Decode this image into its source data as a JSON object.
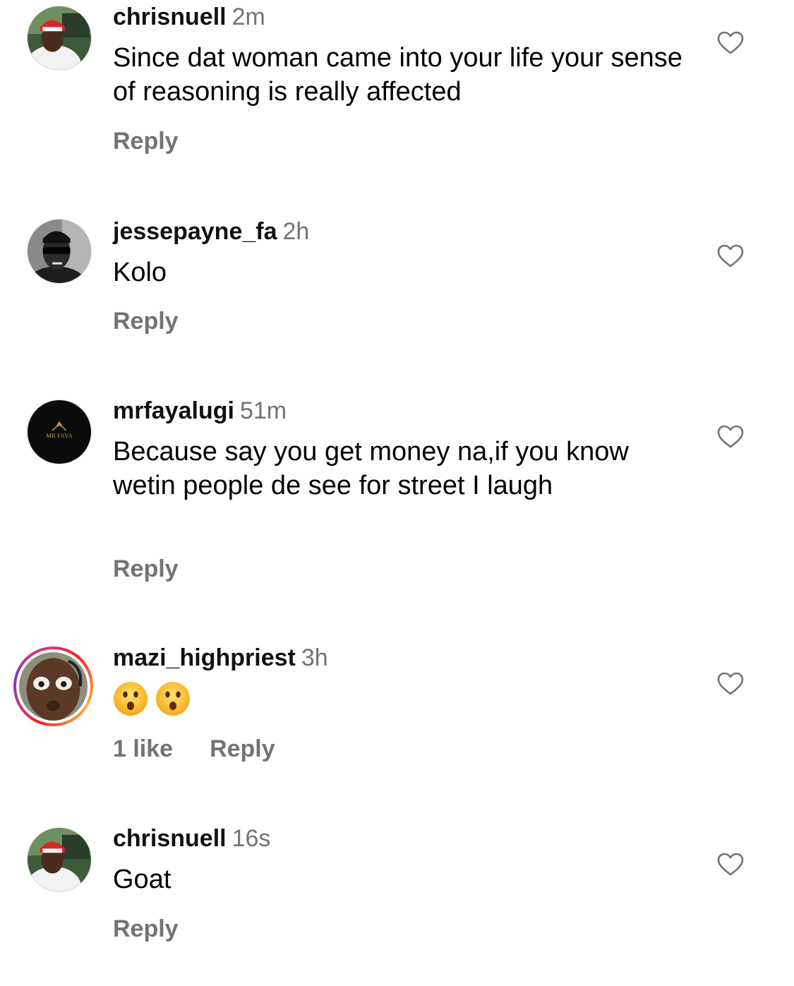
{
  "comments": [
    {
      "username": "chrisnuell",
      "time": "2m",
      "text": "Since dat woman came into your life your sense of reasoning is really affected",
      "reply_label": "Reply",
      "avatar_icon": "profile-photo-red-cap"
    },
    {
      "username": "jessepayne_fa",
      "time": "2h",
      "text": "Kolo",
      "reply_label": "Reply",
      "avatar_icon": "profile-photo-sunglasses-bw"
    },
    {
      "username": "mrfayalugi",
      "time": "51m",
      "text": "Because say you get money na,if you know wetin people de see for street I laugh",
      "reply_label": "Reply",
      "avatar_icon": "mr-faya-logo",
      "avatar_logo_text": "MR FAYA"
    },
    {
      "username": "mazi_highpriest",
      "time": "3h",
      "text": "😮😮",
      "likes_label": "1 like",
      "reply_label": "Reply",
      "avatar_icon": "profile-photo-story-ring"
    },
    {
      "username": "chrisnuell",
      "time": "16s",
      "text": "Goat",
      "reply_label": "Reply",
      "avatar_icon": "profile-photo-red-cap"
    }
  ],
  "colors": {
    "secondary_text": "#737373",
    "primary_text": "#000000",
    "story_ring": [
      "#fd1d1d",
      "#c13584",
      "#833ab4",
      "#fcaf45"
    ]
  }
}
